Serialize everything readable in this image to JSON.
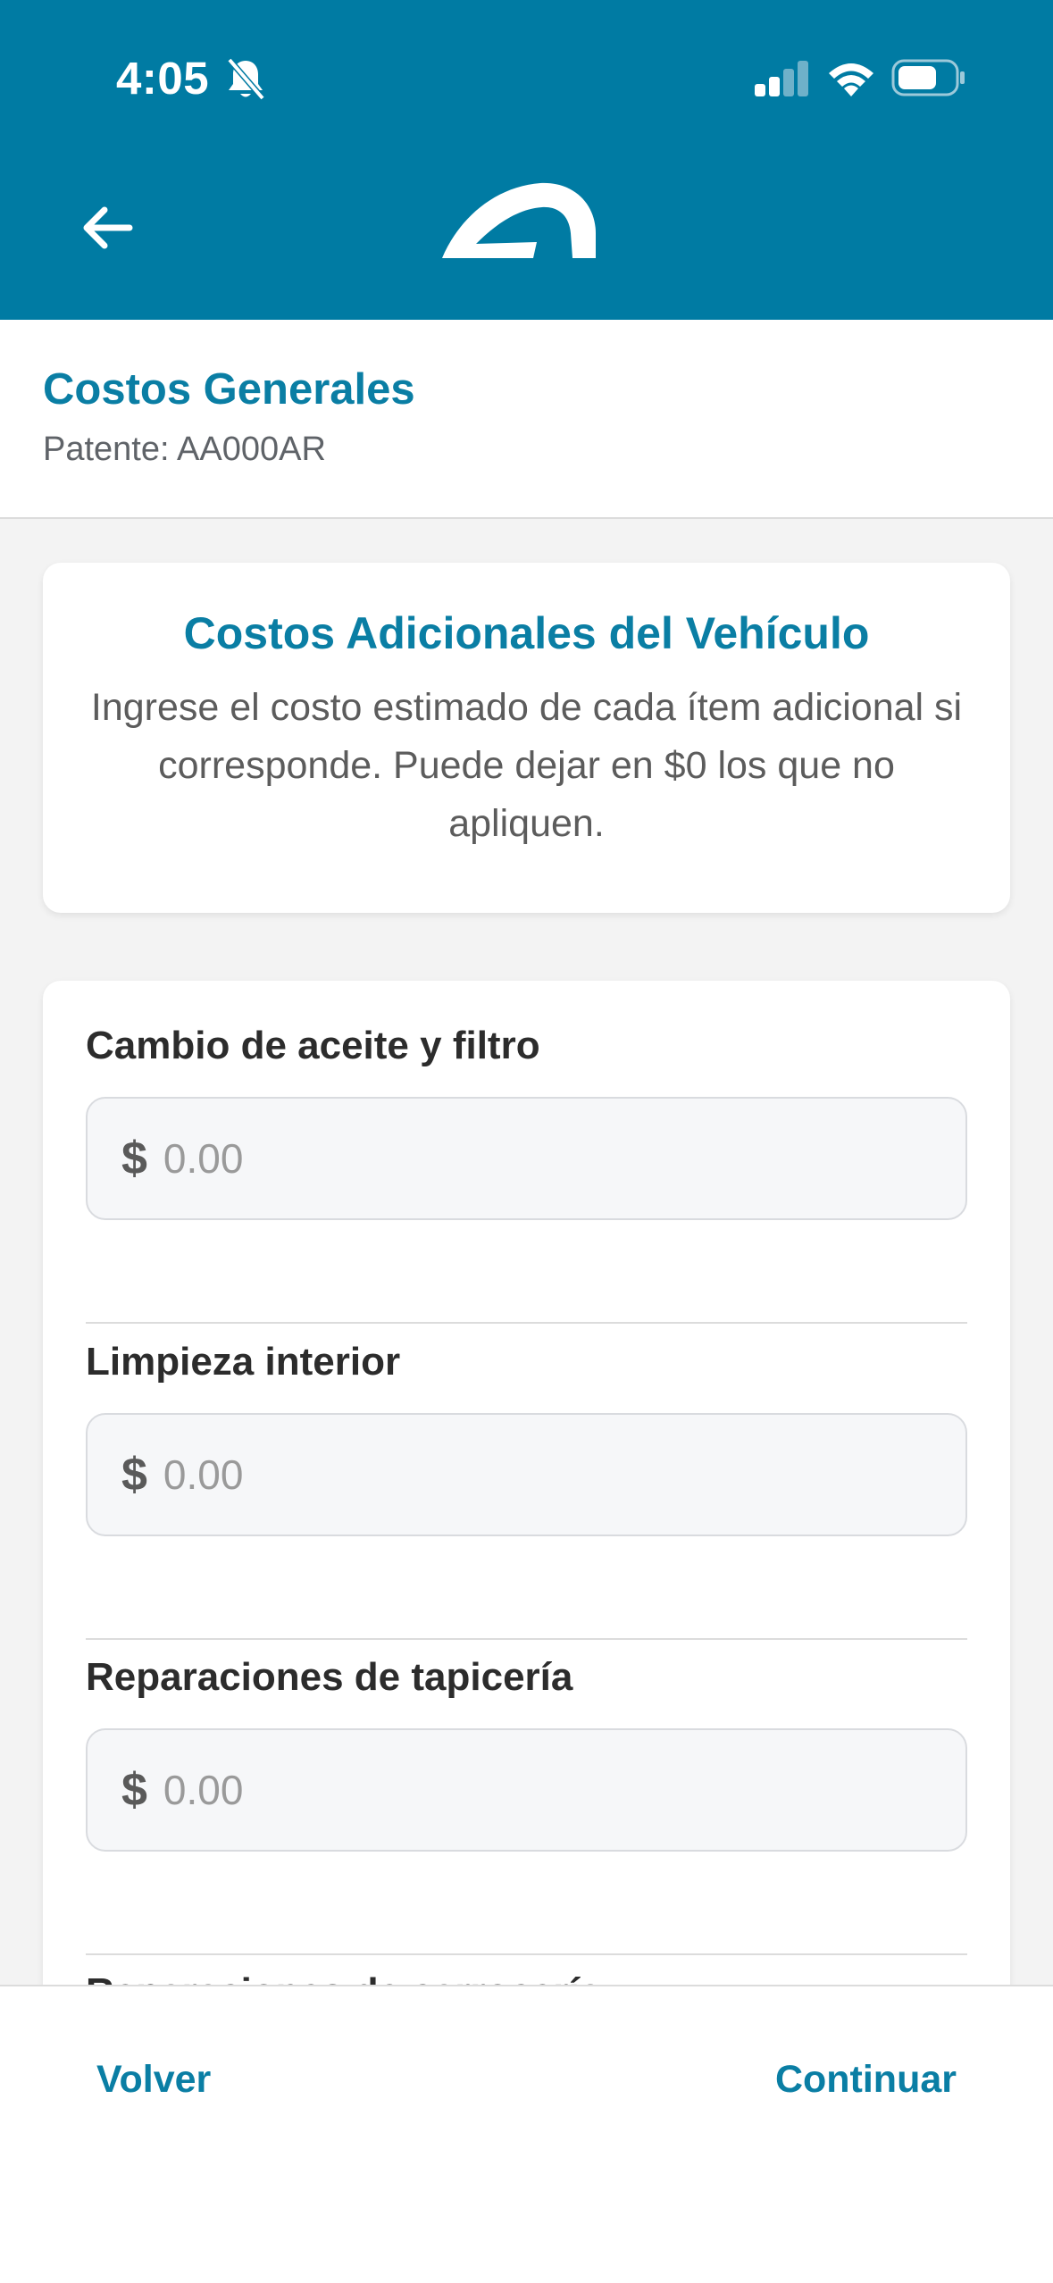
{
  "status_bar": {
    "time": "4:05"
  },
  "header": {
    "icons": {
      "back": "arrow-left-icon",
      "logo": "brand-logo",
      "bell": "bell-off-icon",
      "signal": "signal-icon",
      "wifi": "wifi-icon",
      "battery": "battery-icon"
    }
  },
  "page": {
    "title": "Costos Generales",
    "plate": "Patente: AA000AR"
  },
  "info_card": {
    "title": "Costos Adicionales del Vehículo",
    "text": "Ingrese el costo estimado de cada ítem adicional si corresponde. Puede dejar en $0 los que no apliquen."
  },
  "form": {
    "currency_symbol": "$",
    "items": [
      {
        "label": "Cambio de aceite y filtro",
        "placeholder": "0.00",
        "value": ""
      },
      {
        "label": "Limpieza interior",
        "placeholder": "0.00",
        "value": ""
      },
      {
        "label": "Reparaciones de tapicería",
        "placeholder": "0.00",
        "value": ""
      }
    ],
    "partial_next_label": "Reparaciones de carrocería"
  },
  "bottom_bar": {
    "back_label": "Volver",
    "continue_label": "Continuar"
  },
  "colors": {
    "header_bg": "#007ba3",
    "accent": "#0a7ea4",
    "page_bg": "#f3f3f3"
  }
}
